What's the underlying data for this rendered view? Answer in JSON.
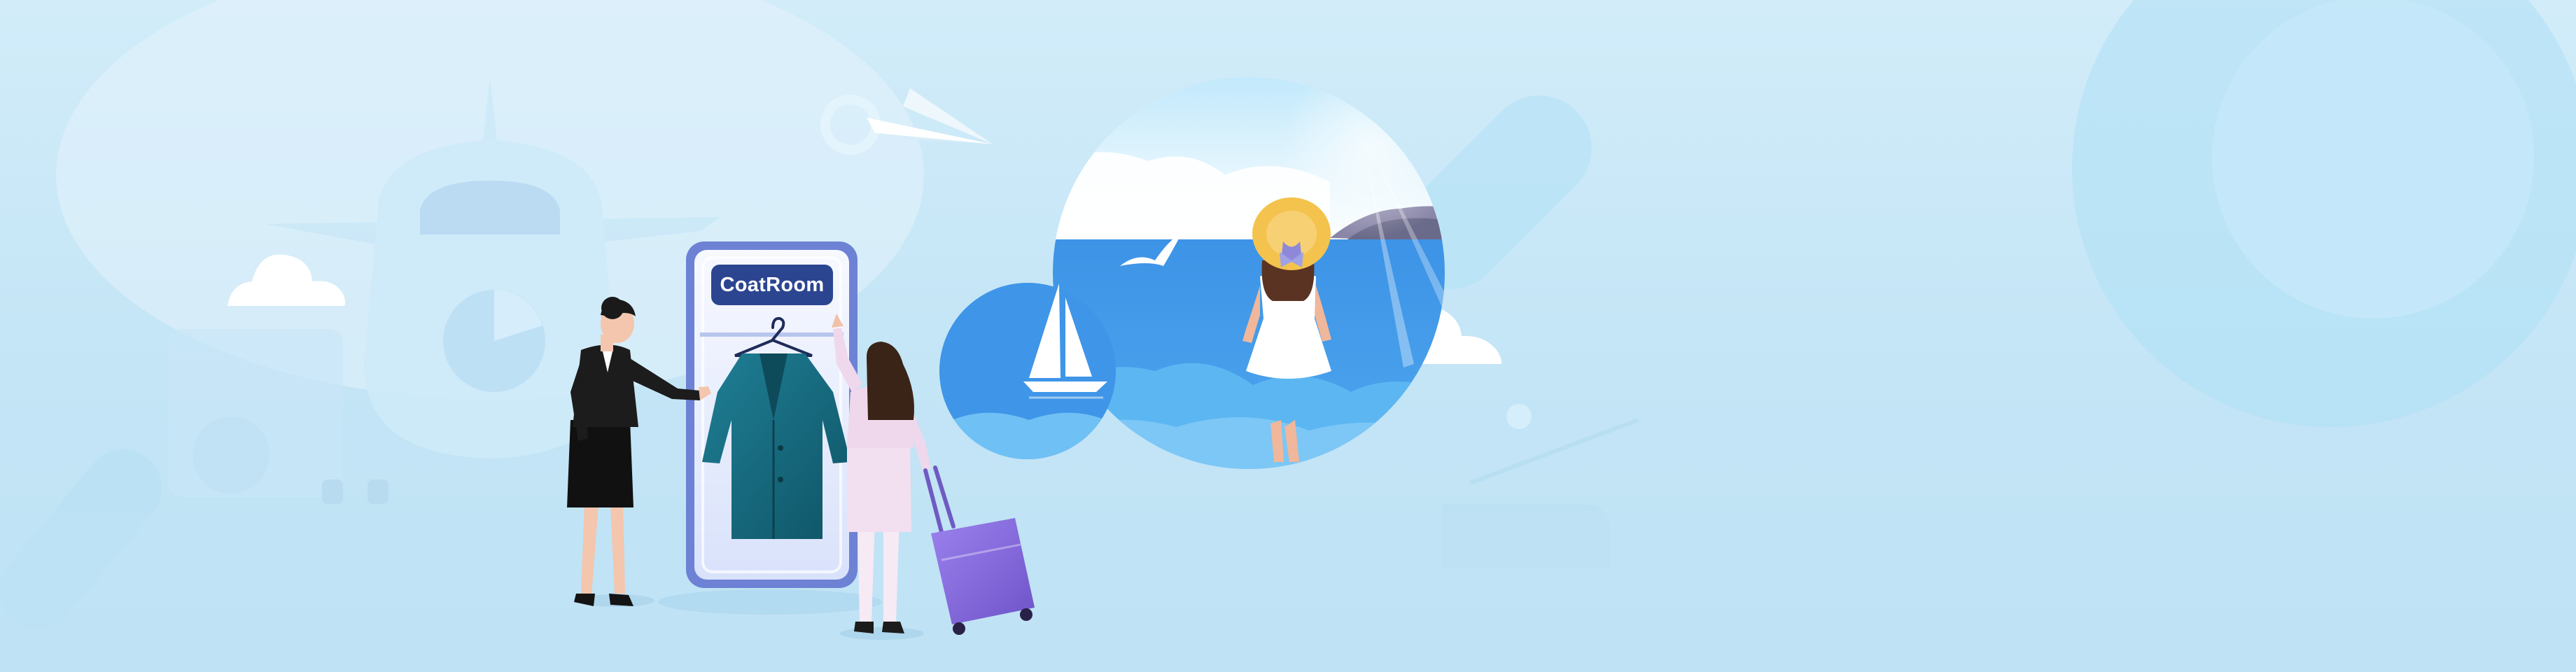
{
  "sign": {
    "label": "CoatRoom"
  },
  "colors": {
    "background": "#c8e8f8",
    "sky_light": "#d6eefa",
    "sea": "#3d93e6",
    "phone_frame": "#6d82d4",
    "sign_bg": "#2c4590",
    "coat": "#176a7e",
    "suitcase": "#8a6ee0",
    "hat": "#f2c24c",
    "stewardess_uniform": "#1c1c1c"
  },
  "icons": [
    "airplane-icon",
    "paper-plane-icon",
    "cloud-icon",
    "sailboat-icon",
    "seagull-icon",
    "hanger-icon",
    "suitcase-icon"
  ]
}
